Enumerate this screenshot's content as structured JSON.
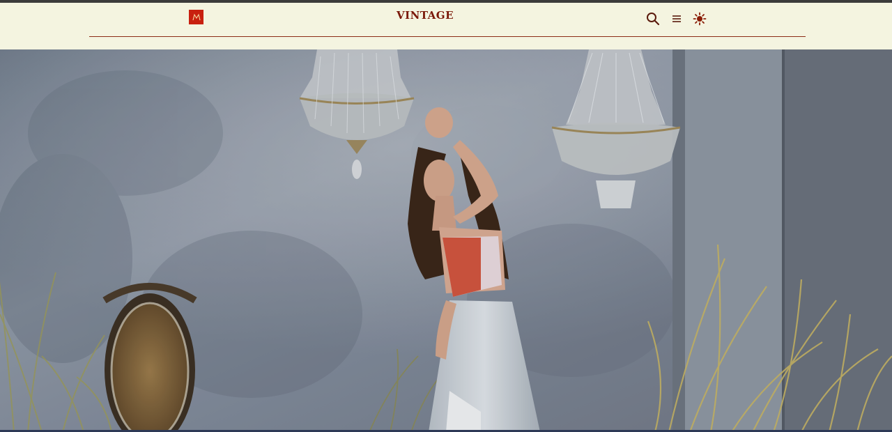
{
  "header": {
    "logo_icon": "brand-m-logo-icon",
    "brand_name": "VINTAGE",
    "icons": {
      "search": "search-icon",
      "menu": "menu-icon",
      "theme": "sun-icon"
    }
  },
  "colors": {
    "background": "#f4f4e0",
    "brand": "#7a1808",
    "logo": "#c8200f",
    "rule": "#8b2a14"
  },
  "hero": {
    "image": "fashion-photo-model-with-chandeliers"
  }
}
